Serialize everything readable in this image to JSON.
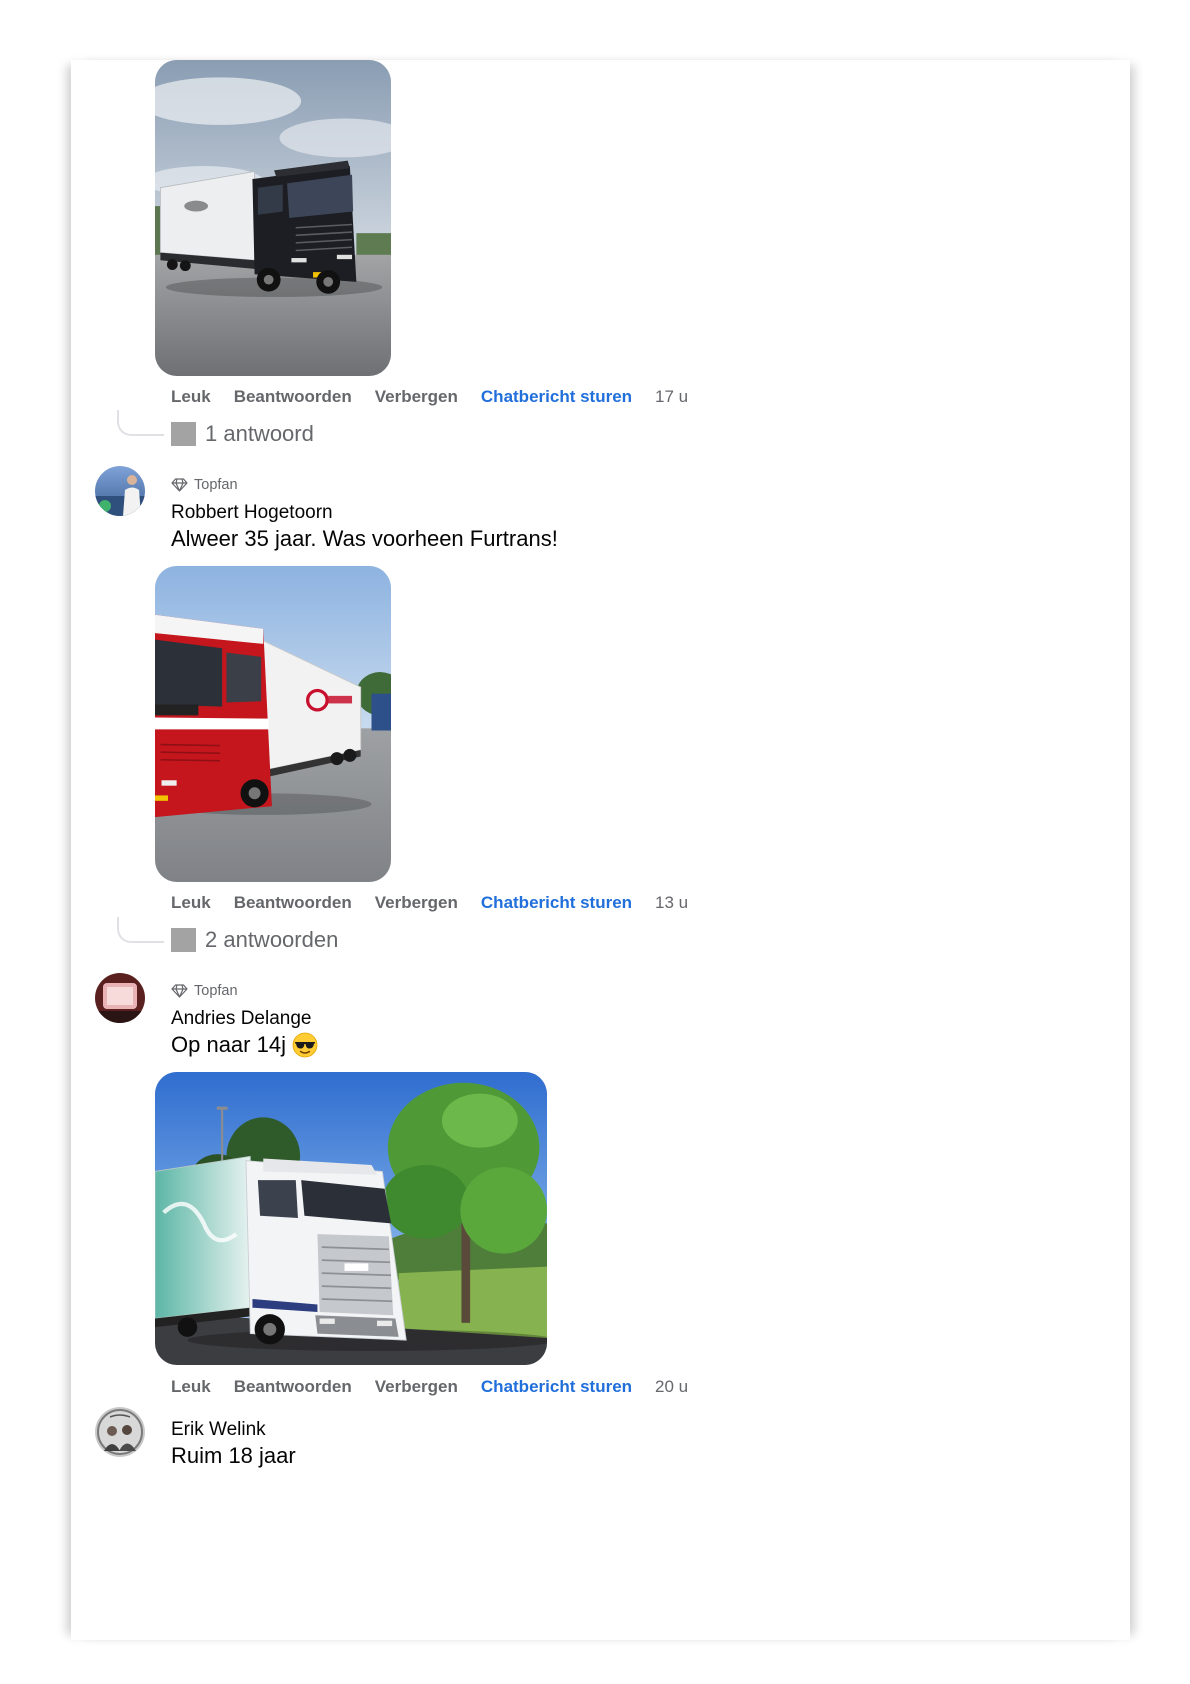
{
  "colors": {
    "link": "#216fdb",
    "meta": "#65676b",
    "text": "#050505",
    "placeholder": "#a3a3a3",
    "connector": "#dfe1e5"
  },
  "actions": {
    "like": "Leuk",
    "reply": "Beantwoorden",
    "hide": "Verbergen",
    "chat": "Chatbericht sturen"
  },
  "comments": [
    {
      "time": "17 u",
      "replies_label": "1 antwoord"
    },
    {
      "badge": "Topfan",
      "author": "Robbert Hogetoorn",
      "text": "Alweer 35 jaar. Was voorheen Furtrans!",
      "time": "13 u",
      "replies_label": "2 antwoorden"
    },
    {
      "badge": "Topfan",
      "author": "Andries Delange",
      "text": "Op naar 14j",
      "emoji": "sunglasses-emoji",
      "time": "20 u"
    },
    {
      "author": "Erik Welink",
      "text": "Ruim 18 jaar"
    }
  ]
}
